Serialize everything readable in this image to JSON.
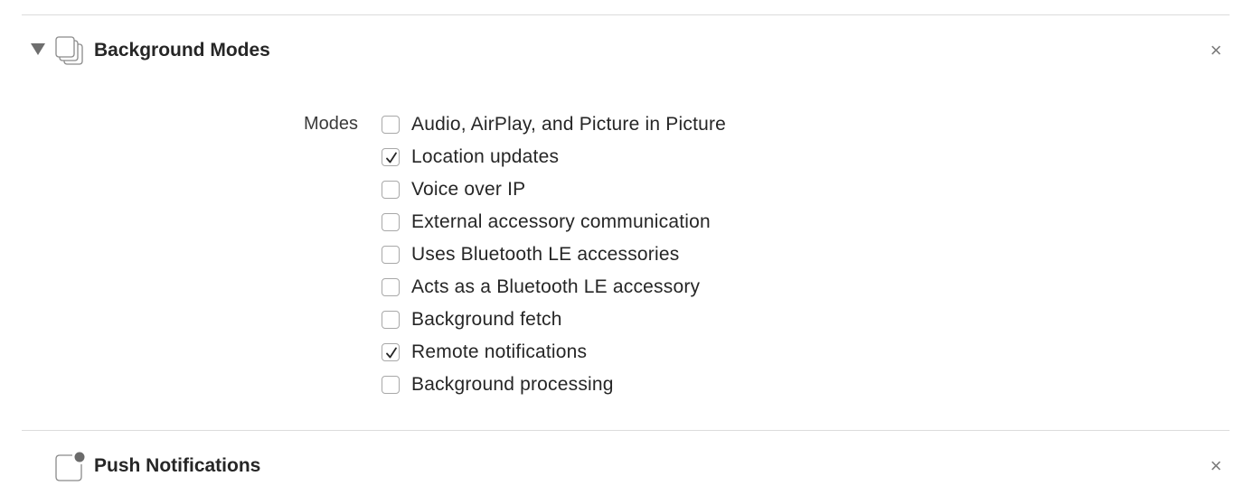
{
  "background_modes": {
    "title": "Background Modes",
    "icon": "background-modes-icon",
    "expanded": true,
    "close_glyph": "×",
    "modes_label": "Modes",
    "modes": [
      {
        "label": "Audio, AirPlay, and Picture in Picture",
        "checked": false
      },
      {
        "label": "Location updates",
        "checked": true
      },
      {
        "label": "Voice over IP",
        "checked": false
      },
      {
        "label": "External accessory communication",
        "checked": false
      },
      {
        "label": "Uses Bluetooth LE accessories",
        "checked": false
      },
      {
        "label": "Acts as a Bluetooth LE accessory",
        "checked": false
      },
      {
        "label": "Background fetch",
        "checked": false
      },
      {
        "label": "Remote notifications",
        "checked": true
      },
      {
        "label": "Background processing",
        "checked": false
      }
    ]
  },
  "push_notifications": {
    "title": "Push Notifications",
    "icon": "push-notifications-icon",
    "close_glyph": "×"
  },
  "colors": {
    "text": "#262626",
    "divider": "#dcdcdc",
    "icon_stroke": "#8a8a8a",
    "close": "#7a7a7a"
  }
}
